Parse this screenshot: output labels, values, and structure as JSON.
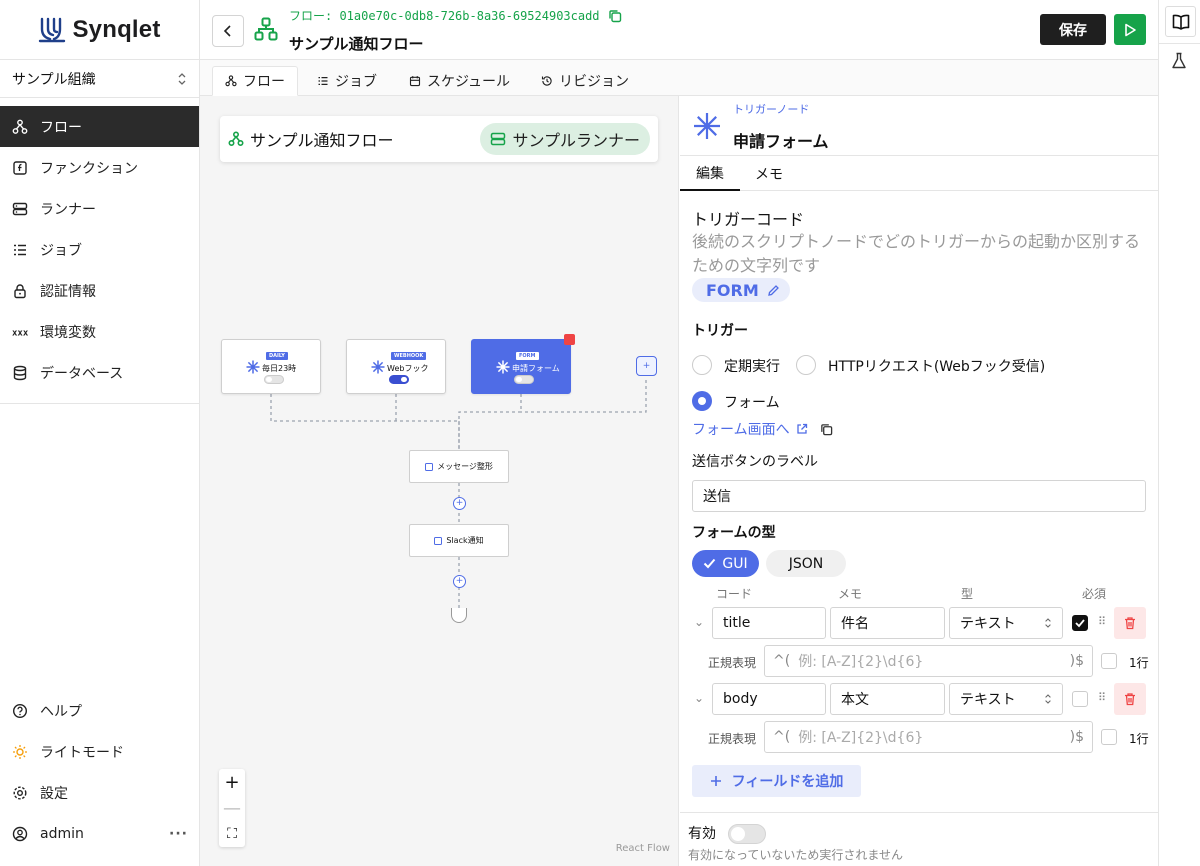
{
  "app": {
    "logo_text": "Synqlet",
    "org_name": "サンプル組織",
    "brand_color": "#4f6ce6",
    "accent_green": "#16a34a"
  },
  "sidebar": {
    "items": [
      {
        "label": "フロー",
        "icon": "flow-icon",
        "active": true
      },
      {
        "label": "ファンクション",
        "icon": "function-icon"
      },
      {
        "label": "ランナー",
        "icon": "server-icon"
      },
      {
        "label": "ジョブ",
        "icon": "list-icon"
      },
      {
        "label": "認証情報",
        "icon": "lock-icon"
      },
      {
        "label": "環境変数",
        "icon": "variable-icon"
      },
      {
        "label": "データベース",
        "icon": "database-icon"
      }
    ],
    "bottom": {
      "help": "ヘルプ",
      "theme": "ライトモード",
      "settings": "設定",
      "user": "admin",
      "more": "···"
    }
  },
  "header": {
    "flow_id": "フロー: 01a0e70c-0db8-726b-8a36-69524903cadd",
    "title": "サンプル通知フロー",
    "save_label": "保存"
  },
  "tabs": [
    {
      "label": "フロー",
      "active": true
    },
    {
      "label": "ジョブ"
    },
    {
      "label": "スケジュール"
    },
    {
      "label": "リビジョン"
    }
  ],
  "canvas": {
    "flow_name": "サンプル通知フロー",
    "runner_name": "サンプルランナー",
    "triggers": [
      {
        "badge": "DAILY",
        "label": "毎日23時",
        "enabled": false
      },
      {
        "badge": "WEBHOOK",
        "label": "Webフック",
        "enabled": true
      },
      {
        "badge": "FORM",
        "label": "申請フォーム",
        "enabled": false,
        "selected": true
      }
    ],
    "steps": [
      {
        "label": "メッセージ整形"
      },
      {
        "label": "Slack通知"
      }
    ],
    "add_symbol": "+",
    "zoom_in": "+",
    "zoom_out": "—",
    "fit": "⛶",
    "attribution": "React Flow"
  },
  "panel": {
    "node_type": "トリガーノード",
    "node_name": "申請フォーム",
    "tabs": {
      "edit": "編集",
      "memo": "メモ"
    },
    "trigger_code_title": "トリガーコード",
    "trigger_code_desc": "後続のスクリプトノードでどのトリガーからの起動か区別するための文字列です",
    "trigger_code_value": "FORM",
    "trigger_title": "トリガー",
    "trigger_options": {
      "scheduled": "定期実行",
      "http": "HTTPリクエスト(Webフック受信)",
      "form": "フォーム"
    },
    "trigger_selected": "フォーム",
    "form_link": "フォーム画面へ",
    "submit_label_title": "送信ボタンのラベル",
    "submit_label_value": "送信",
    "form_type_title": "フォームの型",
    "form_type_gui": "GUI",
    "form_type_json": "JSON",
    "form_type_selected": "GUI",
    "columns": {
      "code": "コード",
      "memo": "メモ",
      "type": "型",
      "required": "必須"
    },
    "fields": [
      {
        "code": "title",
        "memo": "件名",
        "type": "テキスト",
        "required": true,
        "regex_label": "正規表現",
        "regex_prefix": "^(",
        "regex_placeholder": "例: [A-Z]{2}\\d{6}",
        "regex_suffix": ")$",
        "single_line": false,
        "single_line_label": "1行"
      },
      {
        "code": "body",
        "memo": "本文",
        "type": "テキスト",
        "required": false,
        "regex_label": "正規表現",
        "regex_prefix": "^(",
        "regex_placeholder": "例: [A-Z]{2}\\d{6}",
        "regex_suffix": ")$",
        "single_line": false,
        "single_line_label": "1行"
      }
    ],
    "add_field": "フィールドを追加",
    "enabled_label": "有効",
    "enabled": false,
    "enabled_note": "有効になっていないため実行されません"
  }
}
